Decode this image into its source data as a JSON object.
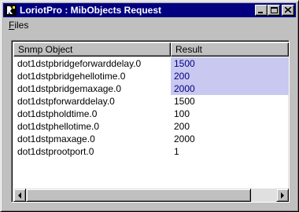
{
  "window": {
    "title": "LoriotPro : MibObjects Request",
    "buttons": {
      "minimize_icon": "minimize-icon",
      "maximize_icon": "maximize-icon",
      "close_icon": "close-icon"
    }
  },
  "menu": {
    "items": [
      {
        "label": "Files",
        "underline": "F"
      }
    ]
  },
  "table": {
    "columns": [
      "Snmp Object",
      "Result"
    ],
    "rows": [
      {
        "object": "dot1dstpbridgeforwarddelay.0",
        "result": "1500",
        "selected": true
      },
      {
        "object": "dot1dstpbridgehellotime.0",
        "result": "200",
        "selected": true
      },
      {
        "object": "dot1dstpbridgemaxage.0",
        "result": "2000",
        "selected": true
      },
      {
        "object": "dot1dstpforwarddelay.0",
        "result": "1500",
        "selected": false
      },
      {
        "object": "dot1dstpholdtime.0",
        "result": "100",
        "selected": false
      },
      {
        "object": "dot1dstphellotime.0",
        "result": "200",
        "selected": false
      },
      {
        "object": "dot1dstpmaxage.0",
        "result": "2000",
        "selected": false
      },
      {
        "object": "dot1dstprootport.0",
        "result": "1",
        "selected": false
      }
    ]
  },
  "colors": {
    "titlebar": "#000080",
    "selection": "#c8c8f0",
    "selection_text": "#000080"
  }
}
